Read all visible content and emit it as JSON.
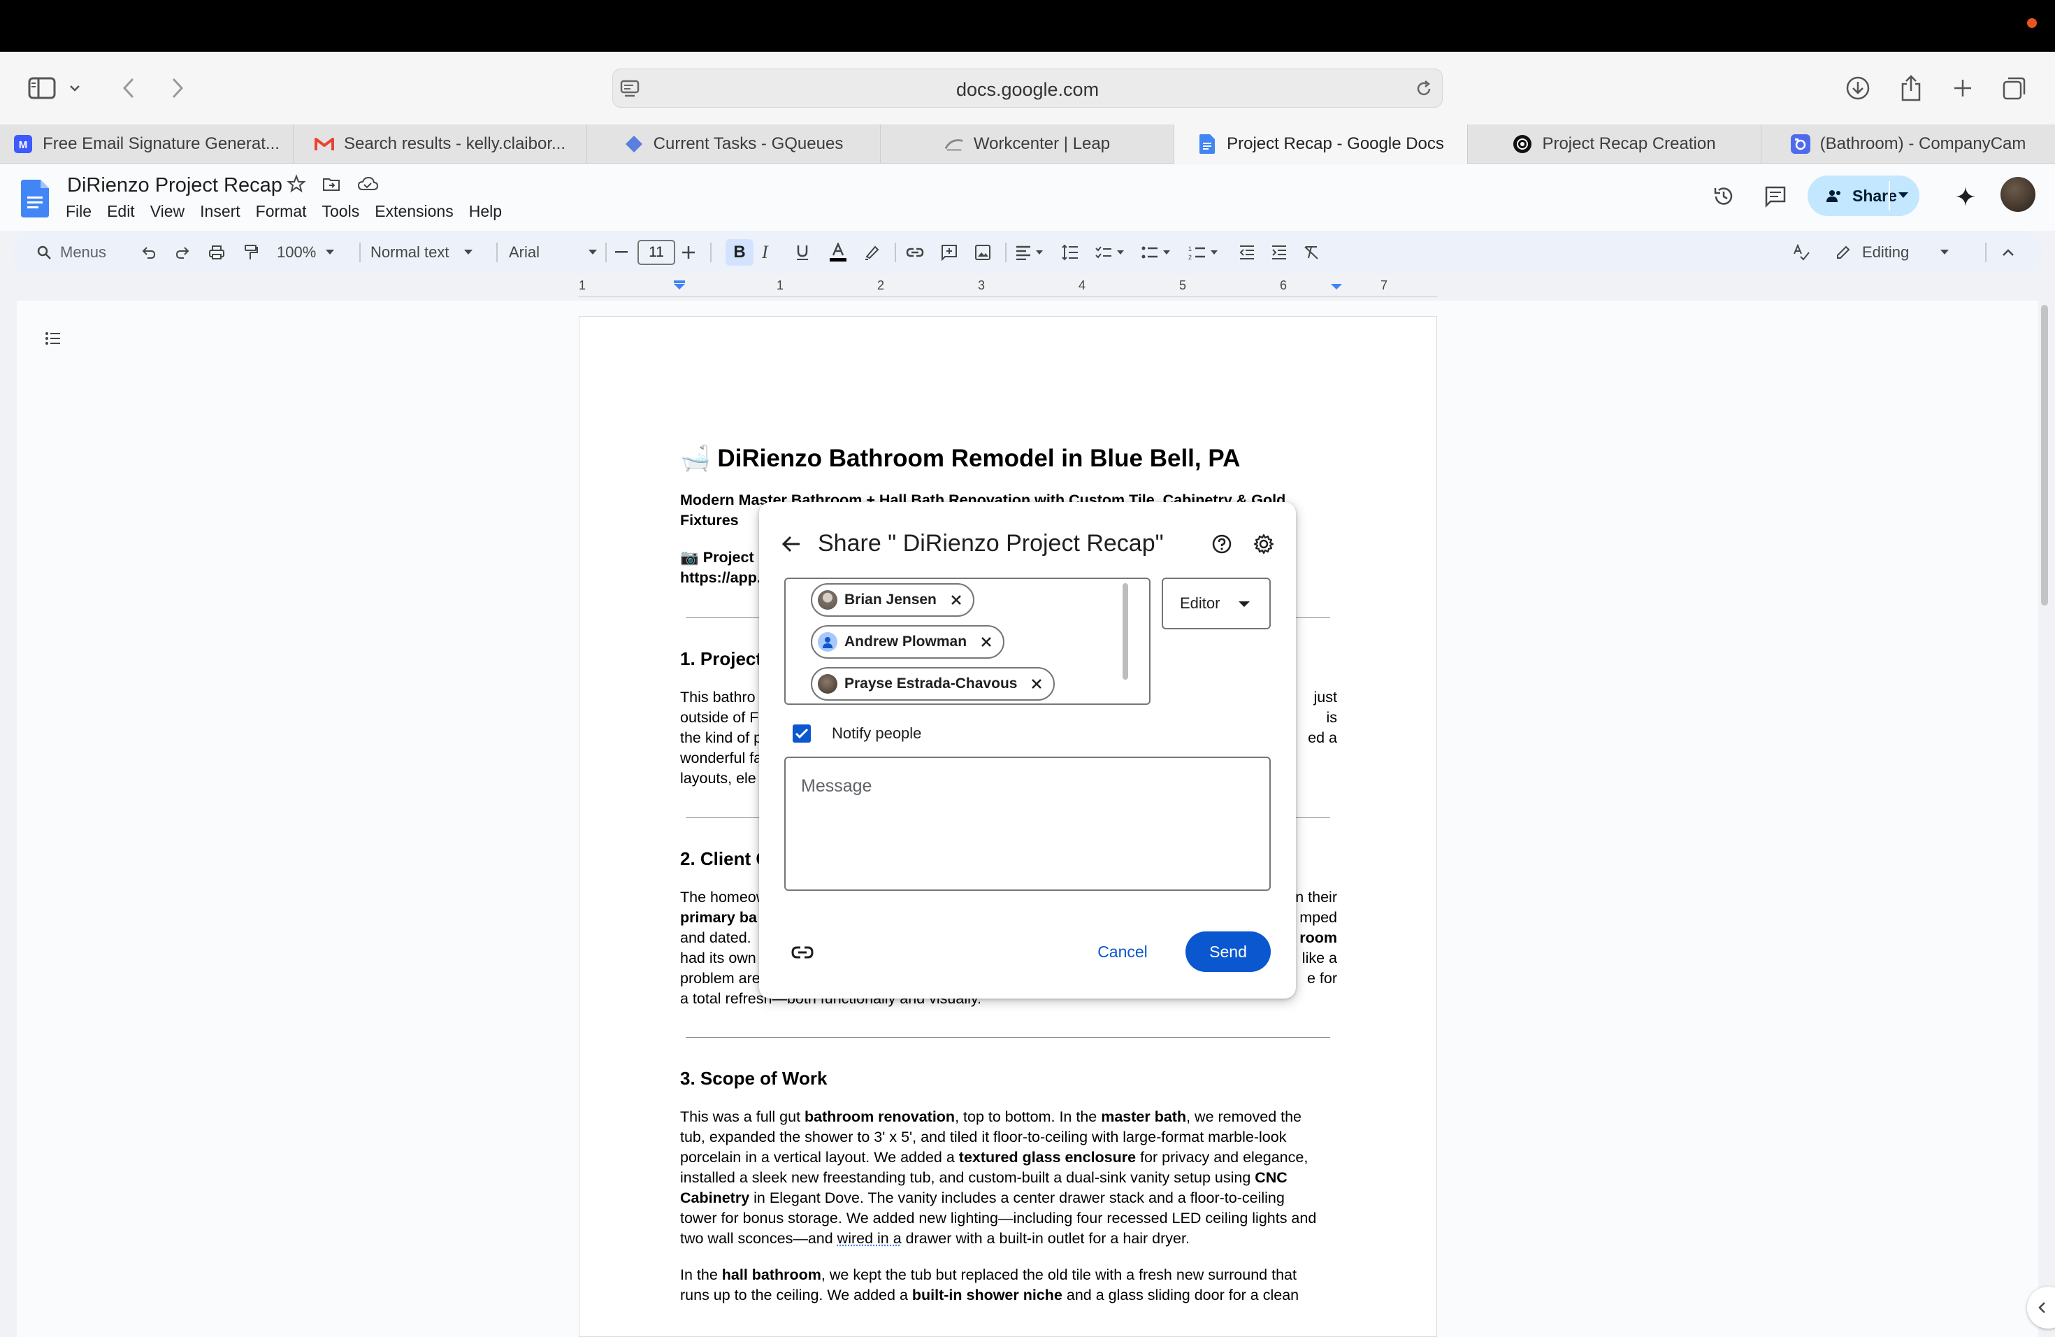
{
  "browser": {
    "url": "docs.google.com",
    "tabs": [
      {
        "label": "Free Email Signature Generat..."
      },
      {
        "label": "Search results - kelly.claibor..."
      },
      {
        "label": "Current Tasks - GQueues"
      },
      {
        "label": "Workcenter | Leap"
      },
      {
        "label": "Project Recap - Google Docs"
      },
      {
        "label": "Project Recap Creation"
      },
      {
        "label": "(Bathroom) - CompanyCam"
      }
    ],
    "active_tab_index": 4
  },
  "docs": {
    "title": "DiRienzo Project Recap",
    "menu": [
      "File",
      "Edit",
      "View",
      "Insert",
      "Format",
      "Tools",
      "Extensions",
      "Help"
    ],
    "share_label": "Share",
    "toolbar": {
      "search_menus": "Menus",
      "zoom": "100%",
      "style": "Normal text",
      "font": "Arial",
      "font_size": "11",
      "bold": "B",
      "mode": "Editing"
    },
    "ruler_numbers": [
      "1",
      "1",
      "2",
      "3",
      "4",
      "5",
      "6",
      "7"
    ]
  },
  "document": {
    "heading_emoji": "🛁",
    "heading": "DiRienzo Bathroom Remodel in Blue Bell, PA",
    "subtitle_line1": "Modern Master Bathroom + Hall Bath Renovation with Custom Tile, Cabinetry & Gold",
    "subtitle_line2": "Fixtures",
    "project_line1_prefix": "📷 Project",
    "project_line2_prefix": "https://app.",
    "section1": "1. Project",
    "section1_lines": [
      "This bathro",
      "outside of F",
      "the kind of p",
      "wonderful fa",
      "layouts, ele"
    ],
    "section1_right": [
      "just",
      "is",
      "ed a",
      "",
      ""
    ],
    "section2": "2. Client C",
    "section2_lines": [
      "The homeow",
      "primary ba",
      "and dated. ",
      "had its own",
      "problem are"
    ],
    "section2_right": [
      "n their",
      "mped",
      "room",
      "like a",
      "e for"
    ],
    "section2_last": "a total refresh—both functionally and visually.",
    "section3": "3. Scope of Work",
    "section3_p1": [
      [
        "This was a full gut ",
        "bathroom renovation",
        ", top to bottom. In the ",
        "master bath",
        ", we removed the"
      ],
      [
        "tub, expanded the shower to 3' x 5', and tiled it floor-to-ceiling with large-format marble-look"
      ],
      [
        "porcelain in a vertical layout. We added a ",
        "textured glass enclosure",
        " for privacy and elegance,"
      ],
      [
        "installed a sleek new freestanding tub, and custom-built a dual-sink vanity setup using ",
        "CNC"
      ],
      [
        "Cabinetry",
        " in Elegant Dove. The vanity includes a center drawer stack and a floor-to-ceiling"
      ],
      [
        "tower for bonus storage. We added new lighting—including four recessed LED ceiling lights and"
      ],
      [
        "two wall sconces—and ",
        "wired in a",
        " drawer with a built-in outlet for a hair dryer."
      ]
    ],
    "section3_p2": [
      [
        "In the ",
        "hall bathroom",
        ", we kept the tub but replaced the old tile with a fresh new surround that"
      ],
      [
        "runs up to the ceiling. We added a ",
        "built-in shower niche",
        " and a glass sliding door for a clean"
      ]
    ]
  },
  "share_dialog": {
    "title": "Share \" DiRienzo Project Recap\"",
    "recipients": [
      {
        "name": "Brian Jensen"
      },
      {
        "name": "Andrew Plowman"
      },
      {
        "name": "Prayse Estrada-Chavous"
      }
    ],
    "role": "Editor",
    "notify_label": "Notify people",
    "notify_checked": true,
    "message_placeholder": "Message",
    "cancel_label": "Cancel",
    "send_label": "Send"
  },
  "colors": {
    "accent": "#0b57d0",
    "share_button": "#c2e7ff",
    "toolbar_bg": "#edf2fa"
  }
}
